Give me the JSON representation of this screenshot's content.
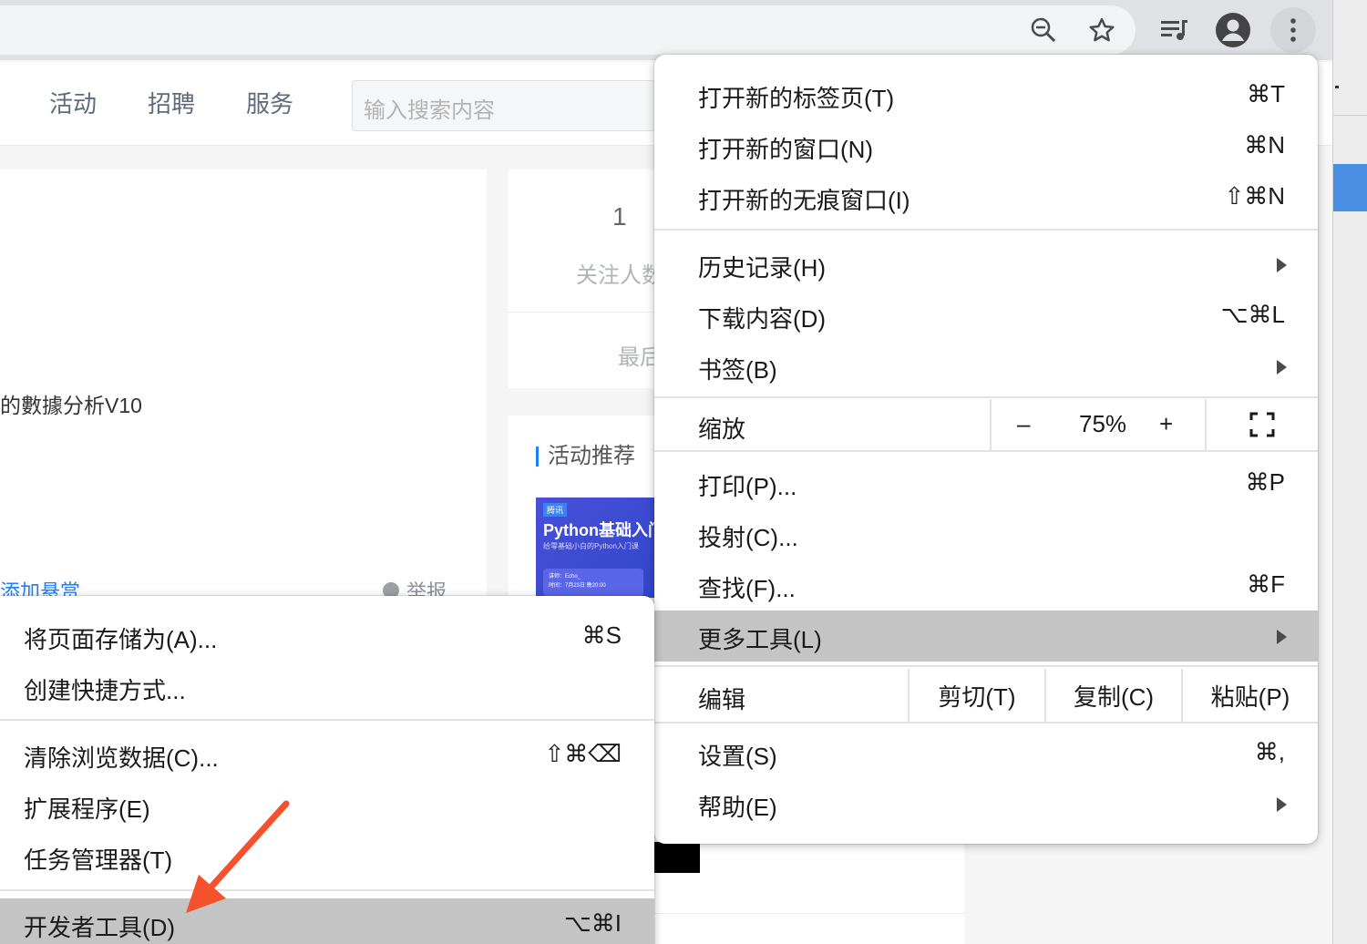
{
  "browser": {
    "icons": [
      "zoom-icon",
      "star-icon",
      "media-icon",
      "profile-icon",
      "menu-icon"
    ]
  },
  "page": {
    "nav": [
      "活动",
      "招聘",
      "服务"
    ],
    "search_placeholder": "输入搜索内容",
    "question_fragment": "的數據分析V10",
    "bounty_link": "添加悬赏",
    "report": "举报",
    "stats": {
      "count": "1",
      "label": "关注人数",
      "last": "最后"
    },
    "activity": {
      "title": "活动推荐",
      "image_tag": "腾讯",
      "image_title": "Python基础入门",
      "image_subtitle": "给零基础小白的Python入门课",
      "image_meta_1": "讲师：Echo_",
      "image_meta_2": "时间：7月23日 晚20:00"
    }
  },
  "chrome_menu": {
    "new_tab": {
      "label": "打开新的标签页(T)",
      "shortcut": "⌘T"
    },
    "new_window": {
      "label": "打开新的窗口(N)",
      "shortcut": "⌘N"
    },
    "incognito": {
      "label": "打开新的无痕窗口(I)",
      "shortcut": "⇧⌘N"
    },
    "history": {
      "label": "历史记录(H)"
    },
    "downloads": {
      "label": "下载内容(D)",
      "shortcut": "⌥⌘L"
    },
    "bookmarks": {
      "label": "书签(B)"
    },
    "zoom": {
      "label": "缩放",
      "minus": "–",
      "value": "75%",
      "plus": "+"
    },
    "print": {
      "label": "打印(P)...",
      "shortcut": "⌘P"
    },
    "cast": {
      "label": "投射(C)..."
    },
    "find": {
      "label": "查找(F)...",
      "shortcut": "⌘F"
    },
    "more_tools": {
      "label": "更多工具(L)"
    },
    "edit": {
      "label": "编辑",
      "cut": "剪切(T)",
      "copy": "复制(C)",
      "paste": "粘贴(P)"
    },
    "settings": {
      "label": "设置(S)",
      "shortcut": "⌘,"
    },
    "help": {
      "label": "帮助(E)"
    }
  },
  "more_tools_menu": {
    "save_page": {
      "label": "将页面存储为(A)...",
      "shortcut": "⌘S"
    },
    "create_shortcut": {
      "label": "创建快捷方式..."
    },
    "clear_data": {
      "label": "清除浏览数据(C)...",
      "shortcut": "⇧⌘⌫"
    },
    "extensions": {
      "label": "扩展程序(E)"
    },
    "task_manager": {
      "label": "任务管理器(T)"
    },
    "devtools": {
      "label": "开发者工具(D)",
      "shortcut": "⌥⌘I"
    }
  },
  "colors": {
    "highlight": "#c4c4c4",
    "link": "#1e80ff",
    "annotation_arrow": "#f4512c"
  }
}
